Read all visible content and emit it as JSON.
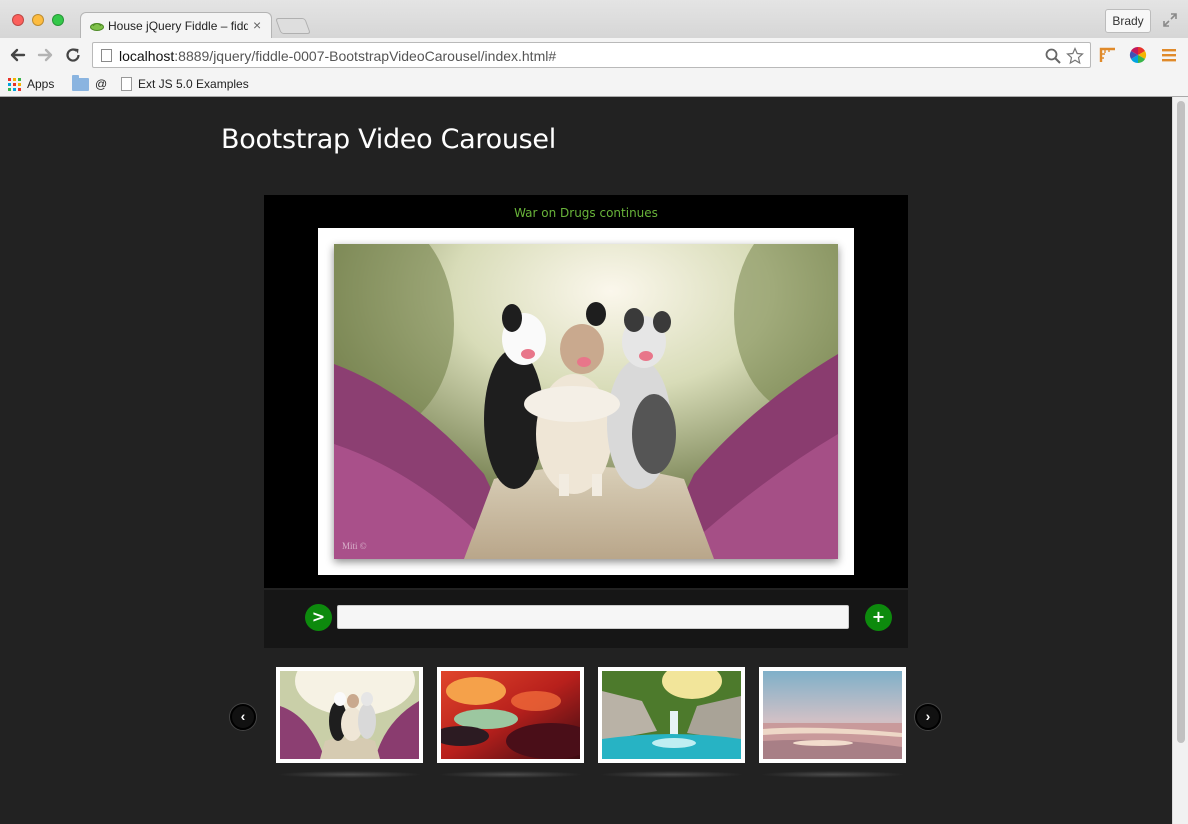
{
  "browser": {
    "tab_title": "House jQuery Fiddle – fiddl",
    "profile_name": "Brady",
    "url_host": "localhost",
    "url_rest": ":8889/jquery/fiddle-0007-BootstrapVideoCarousel/index.html#",
    "bookmarks": [
      {
        "label": "Apps",
        "icon": "apps-grid-icon"
      },
      {
        "label": "@",
        "icon": "folder-icon"
      },
      {
        "label": "Ext JS 5.0 Examples",
        "icon": "page-icon"
      }
    ]
  },
  "page": {
    "title": "Bootstrap Video Carousel",
    "caption": "War on Drugs continues",
    "photo_credit": "Miti ©",
    "main_image": "three dogs hugging on a path through purple heather",
    "controls": {
      "play_label": ">",
      "add_label": "+",
      "input_value": ""
    },
    "carousel": {
      "prev_label": "‹",
      "next_label": "›",
      "thumbnails": [
        {
          "subject": "dogs in heather",
          "active": true
        },
        {
          "subject": "red sunset sky",
          "active": false
        },
        {
          "subject": "waterfall in green forest",
          "active": false
        },
        {
          "subject": "beach at sunset",
          "active": false
        }
      ]
    }
  },
  "colors": {
    "page_bg": "#222222",
    "caption": "#69b43a",
    "button_green": "#0d8a0d",
    "stage_bg": "#000000"
  }
}
